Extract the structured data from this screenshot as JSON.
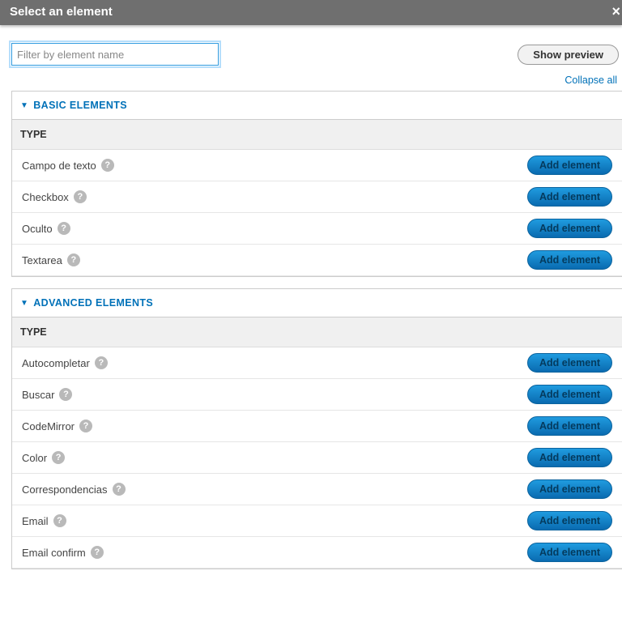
{
  "modal_title": "Select an element",
  "filter_placeholder": "Filter by element name",
  "show_preview_label": "Show preview",
  "collapse_all_label": "Collapse all",
  "type_header_label": "TYPE",
  "add_element_label": "Add element",
  "help_glyph": "?",
  "close_glyph": "×",
  "triangle_glyph": "▼",
  "sections": [
    {
      "title": "BASIC ELEMENTS",
      "items": [
        {
          "label": "Campo de texto"
        },
        {
          "label": "Checkbox"
        },
        {
          "label": "Oculto"
        },
        {
          "label": "Textarea"
        }
      ]
    },
    {
      "title": "ADVANCED ELEMENTS",
      "items": [
        {
          "label": "Autocompletar"
        },
        {
          "label": "Buscar"
        },
        {
          "label": "CodeMirror"
        },
        {
          "label": "Color"
        },
        {
          "label": "Correspondencias"
        },
        {
          "label": "Email"
        },
        {
          "label": "Email confirm"
        }
      ]
    }
  ]
}
